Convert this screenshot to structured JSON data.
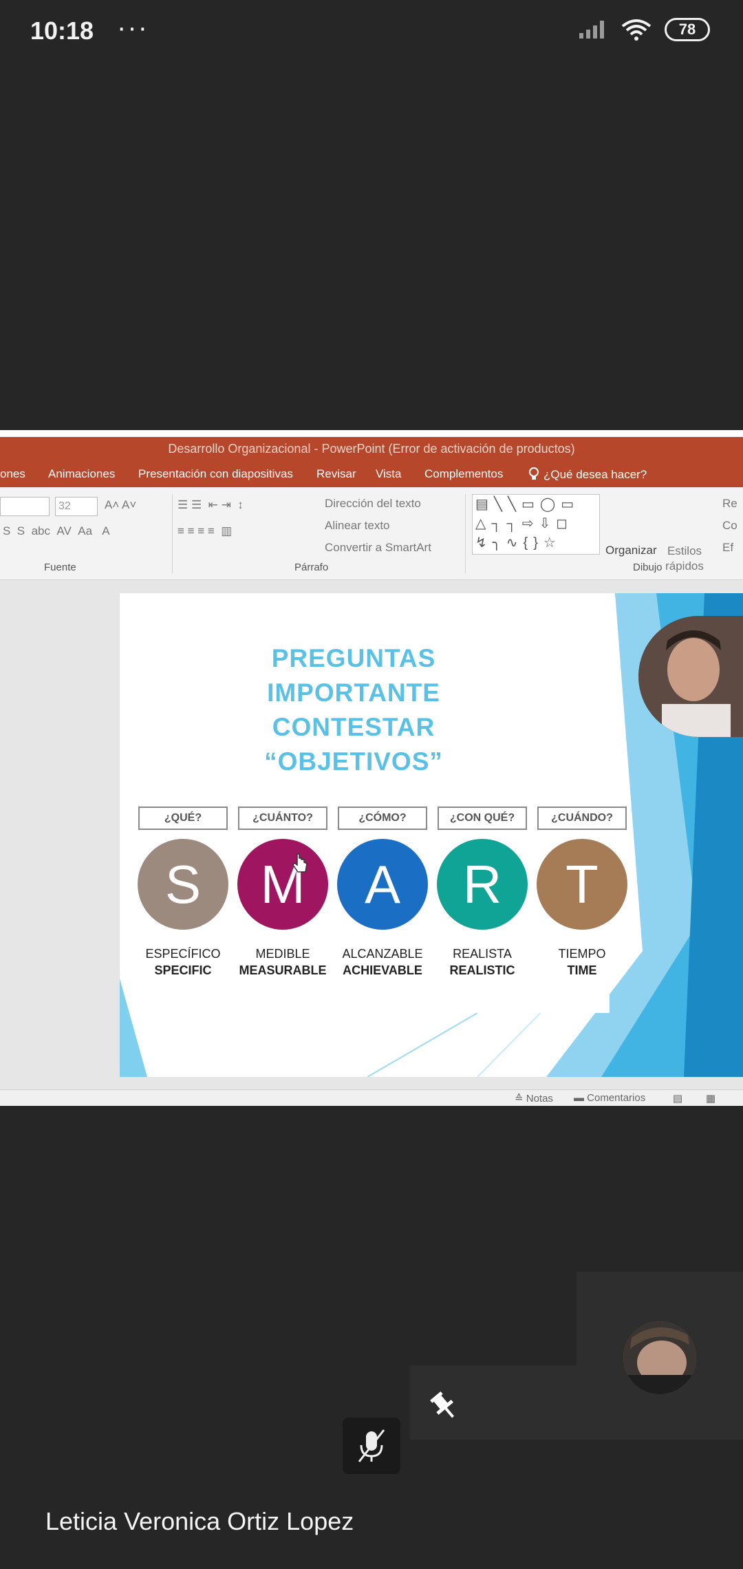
{
  "status_bar": {
    "time": "10:18",
    "dots": "···",
    "battery": "78"
  },
  "ppt": {
    "title": "Desarrollo Organizacional - PowerPoint (Error de activación de productos)",
    "tabs": [
      "ones",
      "Animaciones",
      "Presentación con diapositivas",
      "Revisar",
      "Vista",
      "Complementos",
      "¿Qué desea hacer?"
    ],
    "ribbon": {
      "font_size": "32",
      "paragraph_items": [
        "Dirección del texto",
        "Alinear texto",
        "Convertir a SmartArt"
      ],
      "organize_label": "Organizar",
      "styles_label": "Estilos rápidos",
      "right_items": [
        "Re",
        "Co",
        "Ef"
      ],
      "group_fuente": "Fuente",
      "group_parrafo": "Párrafo",
      "group_dibujo": "Dibujo"
    },
    "statusbar": {
      "notes": "Notas",
      "comments": "Comentarios"
    }
  },
  "slide": {
    "title_lines": [
      "PREGUNTAS",
      "IMPORTANTE CONTESTAR",
      "“OBJETIVOS”"
    ],
    "columns": [
      {
        "question": "¿QUÉ?",
        "letter": "S",
        "es": "ESPECÍFICO",
        "en": "SPECIFIC",
        "color": "#9d8a7f"
      },
      {
        "question": "¿CUÁNTO?",
        "letter": "M",
        "es": "MEDIBLE",
        "en": "MEASURABLE",
        "color": "#a0155f"
      },
      {
        "question": "¿CÓMO?",
        "letter": "A",
        "es": "ALCANZABLE",
        "en": "ACHIEVABLE",
        "color": "#1a6fc4"
      },
      {
        "question": "¿CON QUÉ?",
        "letter": "R",
        "es": "REALISTA",
        "en": "REALISTIC",
        "color": "#0fa496"
      },
      {
        "question": "¿CUÁNDO?",
        "letter": "T",
        "es": "TIEMPO",
        "en": "TIME",
        "color": "#a57c55"
      }
    ]
  },
  "participant": {
    "name": "Leticia Veronica Ortiz Lopez"
  },
  "colors": {
    "background": "#262626",
    "ppt_accent": "#b7472a",
    "slide_title": "#5ac1e6"
  }
}
